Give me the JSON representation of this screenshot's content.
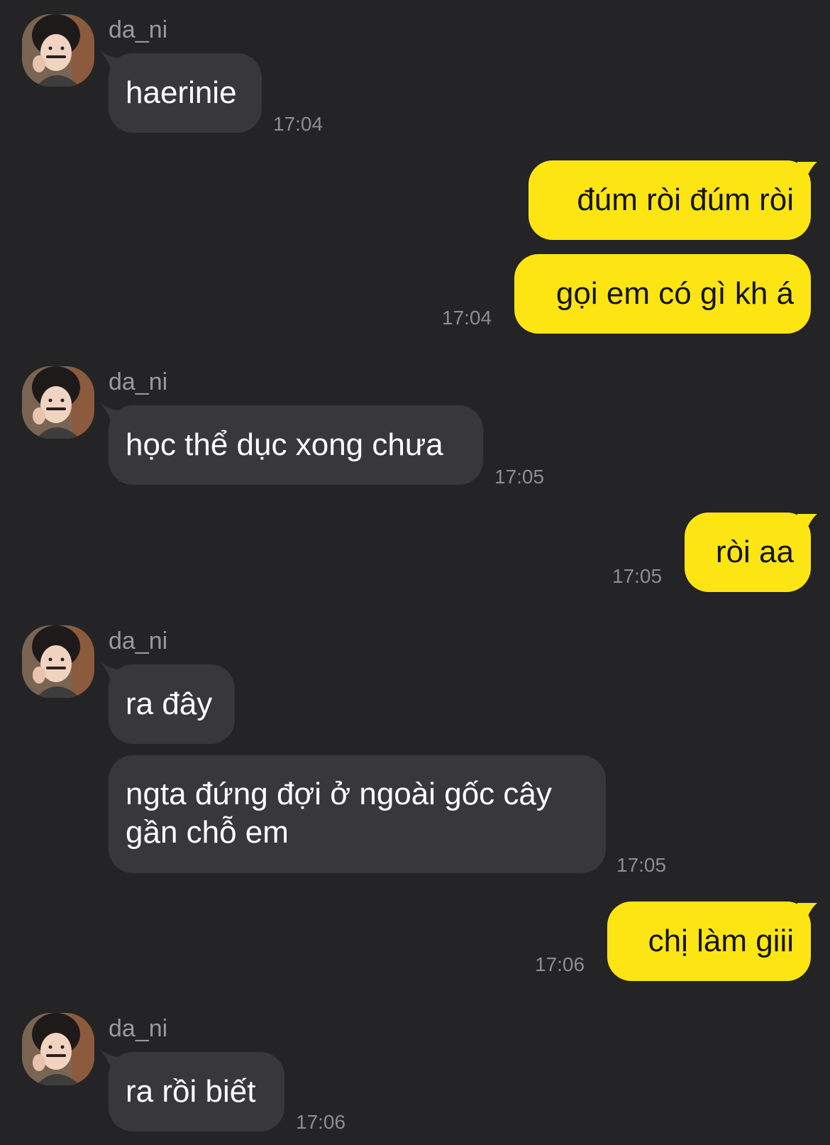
{
  "conversation": {
    "contact_name": "da_ni",
    "messages": [
      {
        "sender": "da_ni",
        "text": "haerinie",
        "time": "17:04"
      },
      {
        "sender": "me",
        "text": "đúm ròi đúm ròi",
        "time": ""
      },
      {
        "sender": "me",
        "text": "gọi em có gì kh á",
        "time": "17:04"
      },
      {
        "sender": "da_ni",
        "text": "học thể dục xong chưa",
        "time": "17:05"
      },
      {
        "sender": "me",
        "text": "ròi aa",
        "time": "17:05"
      },
      {
        "sender": "da_ni",
        "text": "ra đây",
        "time": ""
      },
      {
        "sender": "da_ni",
        "text": "ngta đứng đợi ở ngoài gốc cây gần chỗ em",
        "time": "17:05"
      },
      {
        "sender": "me",
        "text": "chị làm giii",
        "time": "17:06"
      },
      {
        "sender": "da_ni",
        "text": "ra rồi biết",
        "time": "17:06"
      }
    ]
  },
  "colors": {
    "background": "#242426",
    "incoming_bubble": "#38383b",
    "outgoing_bubble": "#fde513",
    "incoming_text": "#ffffff",
    "outgoing_text": "#141414",
    "timestamp": "#8e8e91",
    "sender_name": "#9a9a9d"
  },
  "icons": {
    "avatar": "profile-photo-avatar"
  }
}
